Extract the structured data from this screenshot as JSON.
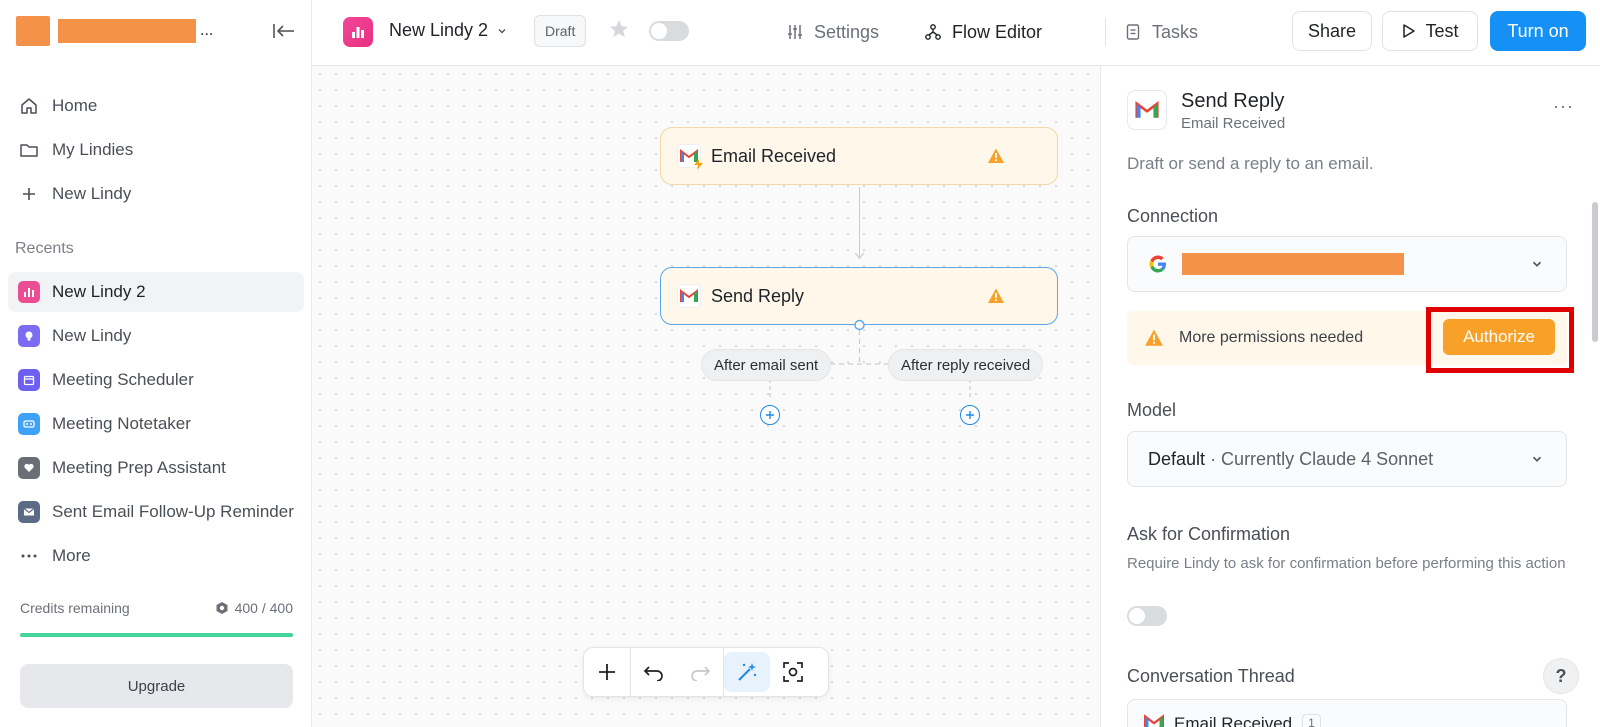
{
  "sidebar": {
    "nav": [
      {
        "label": "Home",
        "icon": "home-icon"
      },
      {
        "label": "My Lindies",
        "icon": "folder-icon"
      },
      {
        "label": "New Lindy",
        "icon": "plus-icon"
      }
    ],
    "recents_heading": "Recents",
    "recents": [
      {
        "label": "New Lindy 2",
        "icon": "bar-chart-icon",
        "color": "#ec4e94"
      },
      {
        "label": "New Lindy",
        "icon": "bulb-icon",
        "color": "#7c6cf2"
      },
      {
        "label": "Meeting Scheduler",
        "icon": "calendar-icon",
        "color": "#6d5ff0"
      },
      {
        "label": "Meeting Notetaker",
        "icon": "caption-icon",
        "color": "#3ea3f7"
      },
      {
        "label": "Meeting Prep Assistant",
        "icon": "heart-icon",
        "color": "#6b6e74"
      },
      {
        "label": "Sent Email Follow-Up Reminder",
        "icon": "mail-icon",
        "color": "#5b6b86"
      }
    ],
    "more_label": "More",
    "credits_label": "Credits remaining",
    "credits_value": "400 / 400",
    "credits_fraction": 1.0,
    "upgrade_label": "Upgrade"
  },
  "topbar": {
    "app_name": "New Lindy 2",
    "status_badge": "Draft",
    "tabs": [
      {
        "label": "Settings",
        "icon": "sliders-icon"
      },
      {
        "label": "Flow Editor",
        "icon": "flow-icon"
      },
      {
        "label": "Tasks",
        "icon": "document-icon"
      }
    ],
    "share_label": "Share",
    "test_label": "Test",
    "turn_on_label": "Turn on"
  },
  "canvas": {
    "trigger_node": "Email Received",
    "action_node": "Send Reply",
    "branches": [
      "After email sent",
      "After reply received"
    ]
  },
  "panel": {
    "title": "Send Reply",
    "subtitle": "Email Received",
    "description": "Draft or send a reply to an email.",
    "connection_label": "Connection",
    "permission_text": "More permissions needed",
    "authorize_label": "Authorize",
    "model_label": "Model",
    "model_value": "Default",
    "model_detail": "· Currently Claude 4 Sonnet",
    "confirmation_label": "Ask for Confirmation",
    "confirmation_help": "Require Lindy to ask for confirmation before performing this action",
    "thread_label": "Conversation Thread",
    "thread_value": "Email Received",
    "thread_badge": "1"
  },
  "help_label": "?",
  "colors": {
    "primary": "#1590f5",
    "warning": "#f7a128",
    "redaction": "#f5924a",
    "highlight": "#e00000"
  }
}
